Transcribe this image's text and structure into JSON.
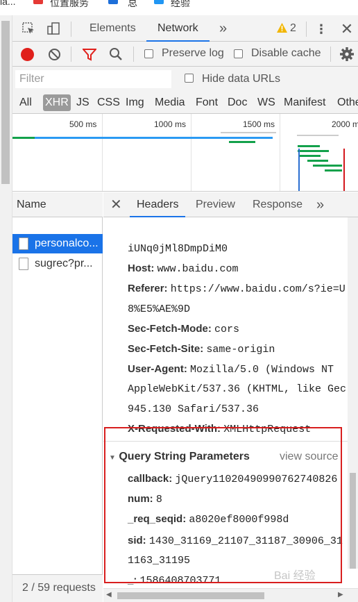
{
  "bookmarks": [
    {
      "label": "ia...",
      "color": ""
    },
    {
      "label": "位置服务",
      "color": "#e53935"
    },
    {
      "label": "总",
      "color": "#1e6fd9"
    },
    {
      "label": "经验",
      "color": "#2196f3"
    }
  ],
  "devtools_tabs": {
    "elements": "Elements",
    "network": "Network",
    "more": "»",
    "warnings_count": "2"
  },
  "toolbar": {
    "preserve_log": "Preserve log",
    "disable_cache": "Disable cache"
  },
  "filter": {
    "placeholder": "Filter",
    "hide_data_urls": "Hide data URLs"
  },
  "types": [
    "All",
    "XHR",
    "JS",
    "CSS",
    "Img",
    "Media",
    "Font",
    "Doc",
    "WS",
    "Manifest",
    "Othe"
  ],
  "active_type": "XHR",
  "overview_ticks": [
    "500 ms",
    "1000 ms",
    "1500 ms",
    "2000 m"
  ],
  "requests": {
    "header": "Name",
    "items": [
      "personalco...",
      "sugrec?pr..."
    ],
    "status": "2 / 59 requests"
  },
  "detail_tabs": [
    "Headers",
    "Preview",
    "Response",
    "»"
  ],
  "headers": [
    {
      "key": "",
      "value": "iUNq0jMl8DmpDiM0"
    },
    {
      "key": "Host:",
      "value": "www.baidu.com"
    },
    {
      "key": "Referer:",
      "value": "https://www.baidu.com/s?ie=U"
    },
    {
      "key": "",
      "value": "8%E5%AE%9D"
    },
    {
      "key": "Sec-Fetch-Mode:",
      "value": "cors"
    },
    {
      "key": "Sec-Fetch-Site:",
      "value": "same-origin"
    },
    {
      "key": "User-Agent:",
      "value": "Mozilla/5.0 (Windows NT"
    },
    {
      "key": "",
      "value": "AppleWebKit/537.36 (KHTML, like Gec"
    },
    {
      "key": "",
      "value": "945.130 Safari/537.36"
    },
    {
      "key": "X-Requested-With:",
      "value": "XMLHttpRequest"
    }
  ],
  "query_section": {
    "title": "Query String Parameters",
    "view_source": "view source",
    "params": [
      {
        "key": "callback:",
        "value": "jQuery11020490990762740826"
      },
      {
        "key": "num:",
        "value": "8"
      },
      {
        "key": "_req_seqid:",
        "value": "a8020ef8000f998d"
      },
      {
        "key": "sid:",
        "value": "1430_31169_21107_31187_30906_31"
      },
      {
        "key": "",
        "value": "1163_31195"
      },
      {
        "key": "_:",
        "value": "1586408703771"
      }
    ]
  },
  "watermark": "Bai 经验",
  "colors": {
    "accent": "#1a73e8",
    "record": "#e0201b",
    "highlight_box": "#d81e1e",
    "waterfall_blue": "#2b9af3",
    "waterfall_green": "#13a14b"
  }
}
